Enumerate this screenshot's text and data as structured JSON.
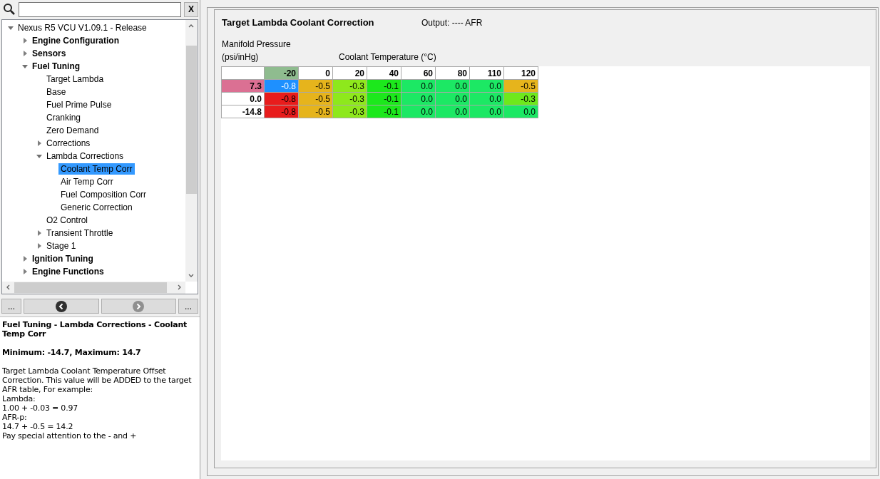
{
  "search": {
    "clear_label": "X"
  },
  "tree": [
    {
      "label": "Nexus R5 VCU V1.09.1 - Release",
      "bold": false,
      "expanded": true,
      "selected": false,
      "children": [
        {
          "label": "Engine Configuration",
          "bold": true,
          "expanded": false,
          "selected": false
        },
        {
          "label": "Sensors",
          "bold": true,
          "expanded": false,
          "selected": false
        },
        {
          "label": "Fuel Tuning",
          "bold": true,
          "expanded": true,
          "selected": false,
          "children": [
            {
              "label": "Target Lambda",
              "selected": false
            },
            {
              "label": "Base",
              "selected": false
            },
            {
              "label": "Fuel Prime Pulse",
              "selected": false
            },
            {
              "label": "Cranking",
              "selected": false
            },
            {
              "label": "Zero Demand",
              "selected": false
            },
            {
              "label": "Corrections",
              "expanded": false,
              "selected": false
            },
            {
              "label": "Lambda Corrections",
              "expanded": true,
              "selected": false,
              "children": [
                {
                  "label": "Coolant Temp Corr",
                  "selected": true
                },
                {
                  "label": "Air Temp Corr",
                  "selected": false
                },
                {
                  "label": "Fuel Composition Corr",
                  "selected": false
                },
                {
                  "label": "Generic Correction",
                  "selected": false
                }
              ]
            },
            {
              "label": "O2 Control",
              "selected": false
            },
            {
              "label": "Transient Throttle",
              "expanded": false,
              "selected": false
            },
            {
              "label": "Stage 1",
              "expanded": false,
              "selected": false
            }
          ]
        },
        {
          "label": "Ignition Tuning",
          "bold": true,
          "expanded": false,
          "selected": false
        },
        {
          "label": "Engine Functions",
          "bold": true,
          "expanded": false,
          "selected": false
        }
      ]
    }
  ],
  "nav": {
    "left_more": "...",
    "right_more": "...",
    "back_disabled": false,
    "forward_disabled": true
  },
  "help": {
    "title": "Fuel Tuning - Lambda Corrections - Coolant Temp Corr",
    "range": "Minimum: -14.7, Maximum: 14.7",
    "lines": [
      "Target Lambda Coolant Temperature Offset Correction. This value will be ADDED to the target AFR table, For example:",
      "Lambda:",
      "1.00 + -0.03 = 0.97",
      "AFR-p:",
      "14.7 + -0.5 = 14.2",
      "Pay special attention to the - and +"
    ]
  },
  "table_panel": {
    "title": "Target Lambda Coolant Correction",
    "output": "Output: ---- AFR",
    "y_axis_label": [
      "Manifold Pressure",
      "(psi/inHg)"
    ],
    "x_axis_label": "Coolant Temperature (°C)",
    "columns": [
      {
        "label": "-20",
        "selected": true
      },
      {
        "label": "0",
        "selected": false
      },
      {
        "label": "20",
        "selected": false
      },
      {
        "label": "40",
        "selected": false
      },
      {
        "label": "60",
        "selected": false
      },
      {
        "label": "80",
        "selected": false
      },
      {
        "label": "110",
        "selected": false
      },
      {
        "label": "120",
        "selected": false
      }
    ],
    "rows": [
      {
        "label": "7.3",
        "selected": true,
        "cells": [
          {
            "value": "-0.8",
            "color": "#1e90ff",
            "selected": true
          },
          {
            "value": "-0.5",
            "color": "#e6b41c",
            "selected": false
          },
          {
            "value": "-0.3",
            "color": "#8ee81c",
            "selected": false
          },
          {
            "value": "-0.1",
            "color": "#1ce81c",
            "selected": false
          },
          {
            "value": "0.0",
            "color": "#1ce864",
            "selected": false
          },
          {
            "value": "0.0",
            "color": "#1ce864",
            "selected": false
          },
          {
            "value": "0.0",
            "color": "#1ce864",
            "selected": false
          },
          {
            "value": "-0.5",
            "color": "#e6b41c",
            "selected": false
          }
        ]
      },
      {
        "label": "0.0",
        "selected": false,
        "cells": [
          {
            "value": "-0.8",
            "color": "#e81c1c",
            "selected": false
          },
          {
            "value": "-0.5",
            "color": "#e6b41c",
            "selected": false
          },
          {
            "value": "-0.3",
            "color": "#8ee81c",
            "selected": false
          },
          {
            "value": "-0.1",
            "color": "#1ce81c",
            "selected": false
          },
          {
            "value": "0.0",
            "color": "#1ce864",
            "selected": false
          },
          {
            "value": "0.0",
            "color": "#1ce864",
            "selected": false
          },
          {
            "value": "0.0",
            "color": "#1ce864",
            "selected": false
          },
          {
            "value": "-0.3",
            "color": "#6ee81c",
            "selected": false
          }
        ]
      },
      {
        "label": "-14.8",
        "selected": false,
        "cells": [
          {
            "value": "-0.8",
            "color": "#e81c1c",
            "selected": false
          },
          {
            "value": "-0.5",
            "color": "#e6b41c",
            "selected": false
          },
          {
            "value": "-0.3",
            "color": "#8ee81c",
            "selected": false
          },
          {
            "value": "-0.1",
            "color": "#1ce81c",
            "selected": false
          },
          {
            "value": "0.0",
            "color": "#1ce864",
            "selected": false
          },
          {
            "value": "0.0",
            "color": "#1ce864",
            "selected": false
          },
          {
            "value": "0.0",
            "color": "#1ce864",
            "selected": false
          },
          {
            "value": "0.0",
            "color": "#1ce864",
            "selected": false
          }
        ]
      }
    ]
  }
}
